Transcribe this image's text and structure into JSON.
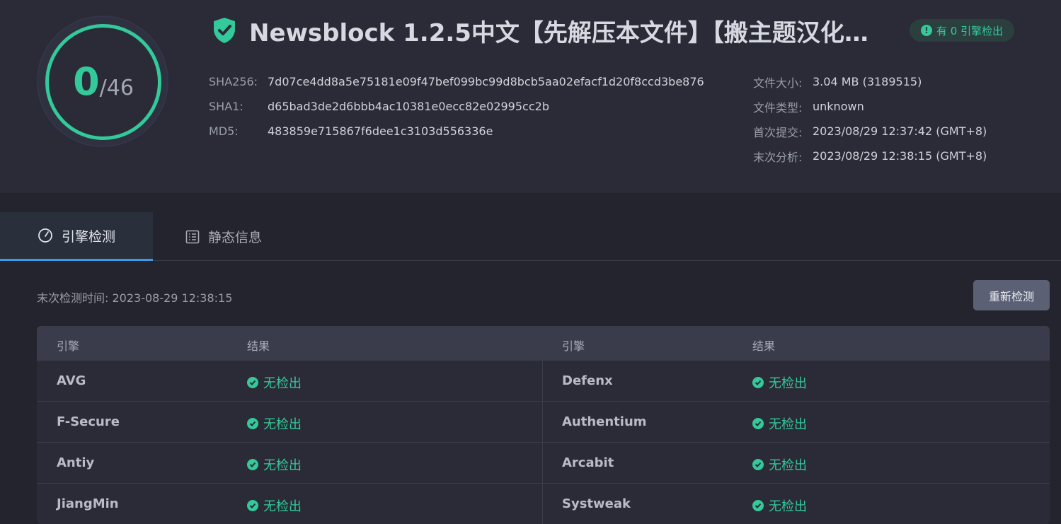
{
  "score": {
    "detected": "0",
    "total": "/46"
  },
  "file": {
    "title": "Newsblock 1.2.5中文【先解压本文件】【搬主题汉化…",
    "badge": "有 0 引擎检出"
  },
  "hashes": [
    {
      "label": "SHA256:",
      "value": "7d07ce4dd8a5e75181e09f47bef099bc99d8bcb5aa02efacf1d20f8ccd3be876"
    },
    {
      "label": "SHA1:",
      "value": "d65bad3de2d6bbb4ac10381e0ecc82e02995cc2b"
    },
    {
      "label": "MD5:",
      "value": "483859e715867f6dee1c3103d556336e"
    }
  ],
  "meta": [
    {
      "label": "文件大小:",
      "value": "3.04 MB (3189515)"
    },
    {
      "label": "文件类型:",
      "value": "unknown"
    },
    {
      "label": "首次提交:",
      "value": "2023/08/29 12:37:42 (GMT+8)"
    },
    {
      "label": "末次分析:",
      "value": "2023/08/29 12:38:15 (GMT+8)"
    }
  ],
  "tabs": [
    {
      "label": "引擎检测",
      "icon": "gauge-icon"
    },
    {
      "label": "静态信息",
      "icon": "document-list-icon"
    }
  ],
  "last_check": "末次检测时间: 2023-08-29 12:38:15",
  "rescan_label": "重新检测",
  "table": {
    "col_engine": "引擎",
    "col_result": "结果",
    "rows": [
      {
        "left_engine": "AVG",
        "left_result": "无检出",
        "right_engine": "Defenx",
        "right_result": "无检出"
      },
      {
        "left_engine": "F-Secure",
        "left_result": "无检出",
        "right_engine": "Authentium",
        "right_result": "无检出"
      },
      {
        "left_engine": "Antiy",
        "left_result": "无检出",
        "right_engine": "Arcabit",
        "right_result": "无检出"
      },
      {
        "left_engine": "JiangMin",
        "left_result": "无检出",
        "right_engine": "Systweak",
        "right_result": "无检出"
      }
    ]
  },
  "colors": {
    "accent": "#33c99a",
    "tab_indicator": "#3a9ce8"
  }
}
